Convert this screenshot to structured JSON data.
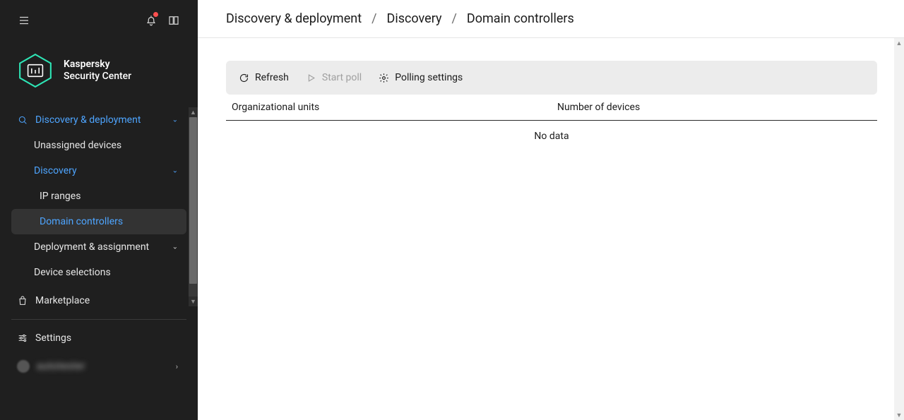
{
  "brand": {
    "line1": "Kaspersky",
    "line2": "Security Center"
  },
  "breadcrumbs": {
    "items": [
      {
        "label": "Discovery & deployment"
      },
      {
        "label": "Discovery"
      },
      {
        "label": "Domain controllers"
      }
    ],
    "sep": "/"
  },
  "sidebar": {
    "nav": {
      "discovery_deployment": "Discovery & deployment",
      "unassigned_devices": "Unassigned devices",
      "discovery": "Discovery",
      "ip_ranges": "IP ranges",
      "domain_controllers": "Domain controllers",
      "deployment_assignment": "Deployment & assignment",
      "device_selections": "Device selections",
      "marketplace": "Marketplace",
      "settings": "Settings"
    },
    "user": "autotester"
  },
  "toolbar": {
    "refresh": "Refresh",
    "start_poll": "Start poll",
    "polling_settings": "Polling settings"
  },
  "table": {
    "headers": {
      "col1": "Organizational units",
      "col2": "Number of devices"
    },
    "empty": "No data"
  }
}
